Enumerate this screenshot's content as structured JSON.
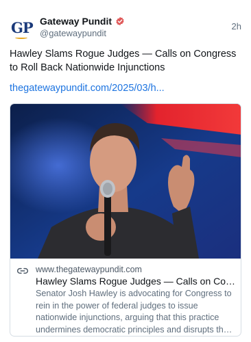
{
  "author": {
    "display_name": "Gateway Pundit",
    "handle": "@gatewaypundit",
    "avatar_text": "GP",
    "verified_icon": "verified-badge-icon",
    "verified_color": "#e05a5a"
  },
  "post": {
    "timestamp": "2h",
    "text": "Hawley Slams Rogue Judges — Calls on Congress to Roll Back Nationwide Injunctions",
    "link_text": "thegatewaypundit.com/2025/03/h...",
    "link_color": "#1d74e0"
  },
  "card": {
    "image_icon": "photo-speaker-with-microphone",
    "domain_icon": "link-icon",
    "domain": "www.thegatewaypundit.com",
    "title": "Hawley Slams Rogue Judges — Calls on Congress to Roll Back Nationwide Injunctions",
    "description": "Senator Josh Hawley is advocating for Congress to rein in the power of federal judges to issue nationwide injunctions, arguing that this practice undermines democratic principles and disrupts the intended balance of power."
  }
}
